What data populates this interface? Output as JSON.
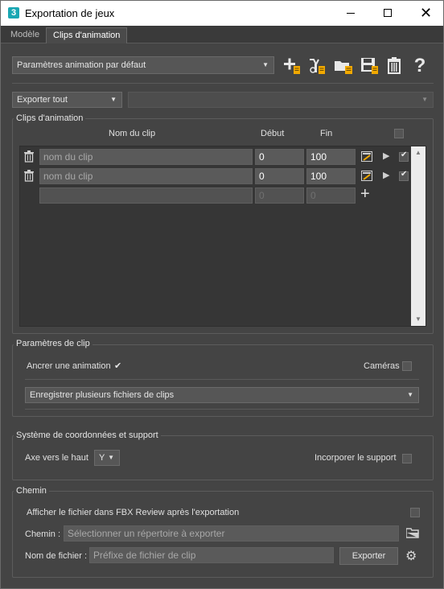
{
  "window": {
    "app_icon": "3",
    "title": "Exportation de jeux"
  },
  "tabs": [
    {
      "label": "Modèle"
    },
    {
      "label": "Clips d'animation"
    }
  ],
  "preset": {
    "value": "Paramètres animation par défaut"
  },
  "toolbar": {
    "icons": [
      "add-preset-icon",
      "add-selection-icon",
      "load-folder-icon",
      "save-icon",
      "delete-icon",
      "help-icon"
    ]
  },
  "export_mode": {
    "value": "Exporter tout",
    "secondary_value": ""
  },
  "clips": {
    "group_title": "Clips d'animation",
    "col_name": "Nom du clip",
    "col_start": "Début",
    "col_end": "Fin",
    "rows": [
      {
        "name_placeholder": "nom du clip",
        "start": "0",
        "end": "100",
        "enabled": true
      },
      {
        "name_placeholder": "nom du clip",
        "start": "0",
        "end": "100",
        "enabled": true
      }
    ],
    "new_row": {
      "start": "0",
      "end": "0"
    }
  },
  "clip_params": {
    "group_title": "Paramètres de clip",
    "anchor_label": "Ancrer une animation",
    "anchor_checked": true,
    "cameras_label": "Caméras",
    "cameras_checked": false,
    "save_mode": "Enregistrer plusieurs fichiers de clips"
  },
  "coords": {
    "group_title": "Système de coordonnées et support",
    "up_axis_label": "Axe vers le haut",
    "up_axis_value": "Y",
    "embed_media_label": "Incorporer le support",
    "embed_media_checked": false
  },
  "path": {
    "group_title": "Chemin",
    "fbx_review_label": "Afficher le fichier dans FBX Review après l'exportation",
    "fbx_review_checked": false,
    "path_label": "Chemin :",
    "path_placeholder": "Sélectionner un répertoire à exporter",
    "filename_label": "Nom de fichier :",
    "filename_placeholder": "Préfixe de fichier de clip",
    "export_button": "Exporter"
  }
}
